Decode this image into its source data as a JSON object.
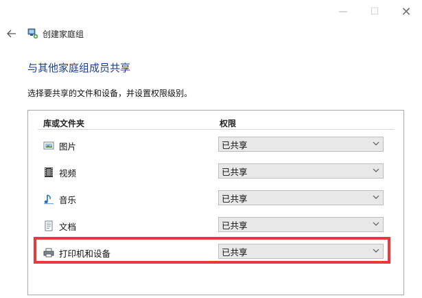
{
  "window": {
    "title": "创建家庭组",
    "controls": {
      "minimize": "—",
      "maximize": "☐",
      "close": "✕"
    }
  },
  "page": {
    "heading": "与其他家庭组成员共享",
    "instruction": "选择要共享的文件和设备，并设置权限级别。"
  },
  "table": {
    "headers": {
      "folder": "库或文件夹",
      "permission": "权限"
    },
    "rows": [
      {
        "label": "图片",
        "icon": "pictures-icon",
        "value": "已共享"
      },
      {
        "label": "视频",
        "icon": "videos-icon",
        "value": "已共享"
      },
      {
        "label": "音乐",
        "icon": "music-icon",
        "value": "已共享"
      },
      {
        "label": "文档",
        "icon": "documents-icon",
        "value": "已共享"
      },
      {
        "label": "打印机和设备",
        "icon": "printer-icon",
        "value": "已共享"
      }
    ]
  },
  "colors": {
    "heading": "#1a3e8a",
    "highlight": "#e8393f",
    "select_bg": "#e8e8e8"
  }
}
